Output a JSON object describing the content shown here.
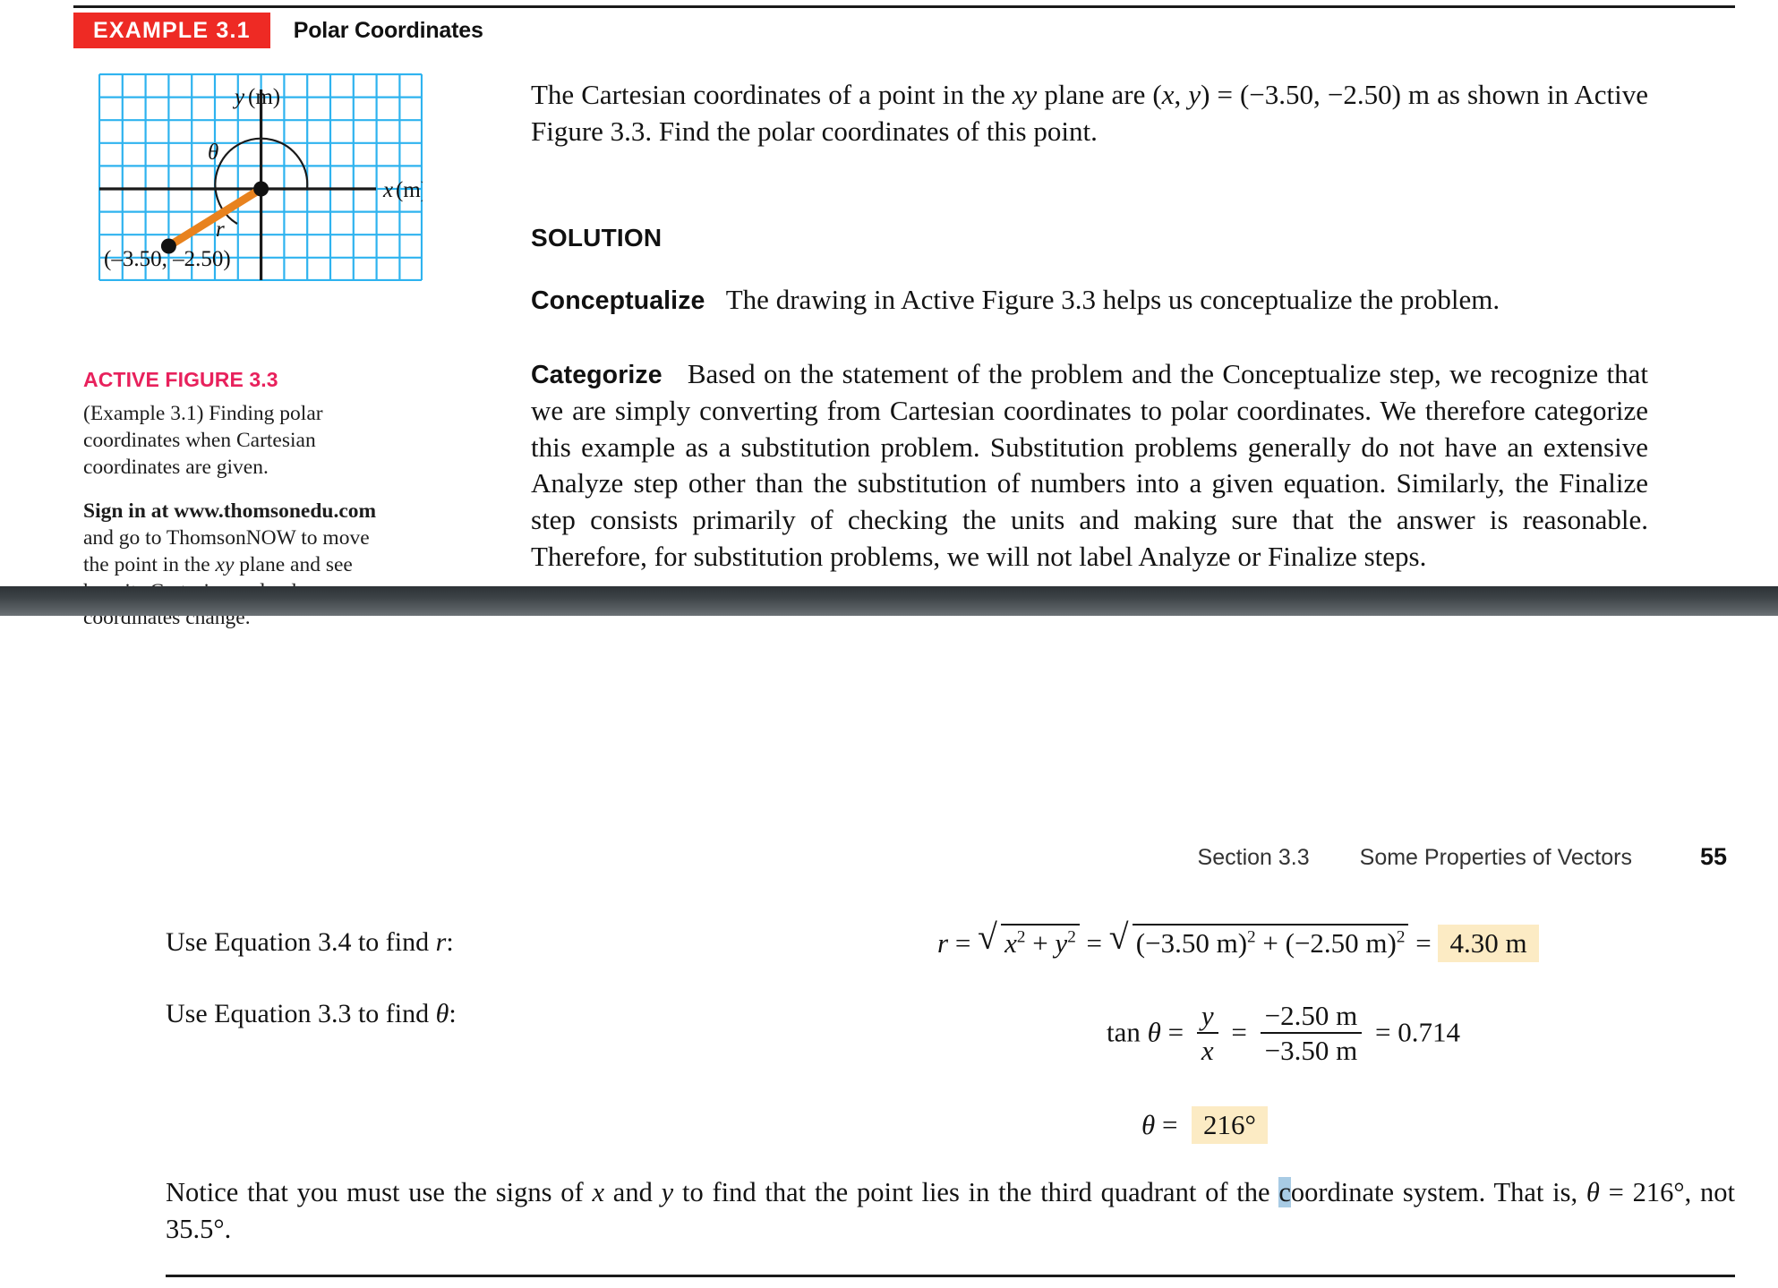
{
  "header": {
    "example_tag": "EXAMPLE 3.1",
    "example_title": "Polar Coordinates"
  },
  "figure": {
    "y_axis_label": "y (m)",
    "x_axis_label": "x (m)",
    "theta_label": "θ",
    "r_label": "r",
    "point_label": "(–3.50, –2.50)",
    "grid_color": "#2eb3ef",
    "ray_color": "#e8821e",
    "axis_color": "#1a1a1a",
    "caption_heading": "ACTIVE FIGURE 3.3",
    "caption_body": "(Example 3.1) Finding polar coordinates when Cartesian coordinates are given.",
    "note_bold": "Sign in at www.thomsonedu.com",
    "note_rest_1": "and go to ThomsonNOW to move the point in the ",
    "note_italic": "xy",
    "note_rest_2": " plane and see how its Cartesian and polar coordinates change."
  },
  "body": {
    "intro_a": "The Cartesian coordinates of a point in the ",
    "intro_xy": "xy",
    "intro_b": " plane are (",
    "intro_x": "x",
    "intro_comma": ", ",
    "intro_y": "y",
    "intro_c": ") = (−3.50, −2.50) m as shown in Active Figure 3.3. Find the polar coordinates of this point.",
    "solution_heading": "SOLUTION",
    "conceptualize_head": "Conceptualize",
    "conceptualize_text": "The drawing in Active Figure 3.3 helps us conceptualize the problem.",
    "categorize_head": "Categorize",
    "categorize_text": "Based on the statement of the problem and the Conceptualize step, we recognize that we are simply converting from Cartesian coordinates to polar coordinates. We therefore categorize this example as a substitution problem. Substitution problems generally do not have an extensive Analyze step other than the substitution of numbers into a given equation. Similarly, the Finalize step consists primarily of checking the units and making sure that the answer is reasonable. Therefore, for substitution problems, we will not label Analyze or Finalize steps."
  },
  "running_head": {
    "section": "Section 3.3",
    "title": "Some Properties of Vectors",
    "page": "55"
  },
  "solution_rows": [
    {
      "label_a": "Use Equation 3.4 to find ",
      "label_var": "r",
      "label_b": ":",
      "math": {
        "lhs_var": "r",
        "eq1": "=",
        "rad1_x": "x",
        "rad1_plus": "+",
        "rad1_y": "y",
        "exp": "2",
        "eq2": "=",
        "rad2": "(−3.50 m)",
        "rad2_plus": "+",
        "rad2b": "(−2.50 m)",
        "eq3": "=",
        "answer": "4.30 m"
      }
    },
    {
      "label_a": "Use Equation 3.3 to find ",
      "label_var": "θ",
      "label_b": ":",
      "math": {
        "tan": "tan",
        "theta": "θ",
        "eq1": "=",
        "num1": "y",
        "den1": "x",
        "eq2": "=",
        "num2": "−2.50 m",
        "den2": "−3.50 m",
        "eq3": "=",
        "value": "0.714"
      }
    }
  ],
  "theta_result": {
    "theta": "θ",
    "equals": "=",
    "answer": "216°"
  },
  "bottom_note": {
    "part1": "Notice that you must use the signs of ",
    "var_x": "x",
    "part2": " and ",
    "var_y": "y",
    "part3": " to find that the point lies in the third quadrant of the ",
    "selected_char": "c",
    "part4": "oordinate system. That is, ",
    "var_theta": "θ",
    "part5": " = 216°, not 35.5°."
  },
  "colors": {
    "example_red": "#ee2a24",
    "figure_pink": "#e8215c",
    "highlight_yellow": "#fcebc4",
    "selection_blue": "#a8cbe4",
    "grid_blue": "#2eb3ef",
    "ray_orange": "#e8821e"
  }
}
